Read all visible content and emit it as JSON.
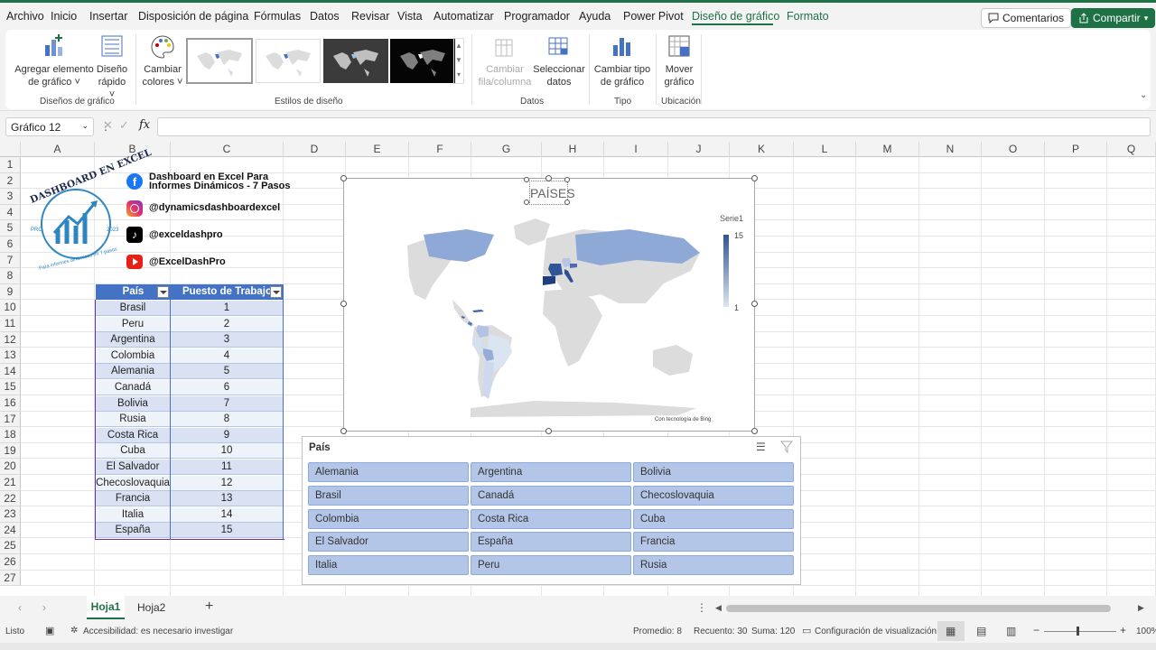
{
  "menu": {
    "items": [
      "Archivo",
      "Inicio",
      "Insertar",
      "Disposición de página",
      "Fórmulas",
      "Datos",
      "Revisar",
      "Vista",
      "Automatizar",
      "Programador",
      "Ayuda",
      "Power Pivot",
      "Diseño de gráfico",
      "Formato"
    ],
    "active": "Diseño de gráfico",
    "comments_label": "Comentarios",
    "share_label": "Compartir"
  },
  "ribbon": {
    "add_element": [
      "Agregar elemento",
      "de gráfico ˅"
    ],
    "quick_layout": [
      "Diseño",
      "rápido ˅"
    ],
    "change_colors": [
      "Cambiar",
      "colores ˅"
    ],
    "switch_row_col": [
      "Cambiar",
      "fila/columna"
    ],
    "select_data": [
      "Seleccionar",
      "datos"
    ],
    "change_type": [
      "Cambiar tipo",
      "de gráfico"
    ],
    "move_chart": [
      "Mover",
      "gráfico"
    ],
    "groups": {
      "layouts": "Diseños de gráfico",
      "styles": "Estilos de diseño",
      "data": "Datos",
      "type": "Tipo",
      "location": "Ubicación"
    }
  },
  "formula": {
    "namebox": "Gráfico 12",
    "fx": "fx"
  },
  "columns": [
    "A",
    "B",
    "C",
    "D",
    "E",
    "F",
    "G",
    "H",
    "I",
    "J",
    "K",
    "L",
    "M",
    "N",
    "O",
    "P",
    "Q"
  ],
  "rows": [
    "1",
    "2",
    "3",
    "4",
    "5",
    "6",
    "7",
    "8",
    "9",
    "10",
    "11",
    "12",
    "13",
    "14",
    "15",
    "16",
    "17",
    "18",
    "19",
    "20",
    "21",
    "22",
    "23",
    "24",
    "25",
    "26",
    "27"
  ],
  "brand": {
    "logo_top": "DASHBOARD EN EXCEL",
    "logo_left": "PRO",
    "logo_right": "2023",
    "logo_bottom": "Para informes dinámicos en 7 pasos",
    "facebook": [
      "Dashboard en Excel Para",
      "Informes Dinámicos -  7 Pasos"
    ],
    "instagram": "@dynamicsdashboardexcel",
    "tiktok": "@exceldashpro",
    "youtube": "@ExcelDashPro"
  },
  "table": {
    "headers": [
      "País",
      "Puesto de Trabajo"
    ],
    "rows": [
      [
        "Brasil",
        "1"
      ],
      [
        "Peru",
        "2"
      ],
      [
        "Argentina",
        "3"
      ],
      [
        "Colombia",
        "4"
      ],
      [
        "Alemania",
        "5"
      ],
      [
        "Canadá",
        "6"
      ],
      [
        "Bolivia",
        "7"
      ],
      [
        "Rusia",
        "8"
      ],
      [
        "Costa Rica",
        "9"
      ],
      [
        "Cuba",
        "10"
      ],
      [
        "El Salvador",
        "11"
      ],
      [
        "Checoslovaquia",
        "12"
      ],
      [
        "Francia",
        "13"
      ],
      [
        "Italia",
        "14"
      ],
      [
        "España",
        "15"
      ]
    ]
  },
  "chart": {
    "title": "PAÍSES",
    "legend_title": "Serie1",
    "legend_max": "15",
    "legend_min": "1",
    "credit": "Con tecnología de Bing",
    "color_low": "#dce6f2",
    "color_high": "#2f5597"
  },
  "chart_data": {
    "type": "map",
    "title": "PAÍSES",
    "series": [
      {
        "name": "Serie1",
        "values": [
          1,
          2,
          3,
          4,
          5,
          6,
          7,
          8,
          9,
          10,
          11,
          12,
          13,
          14,
          15
        ]
      }
    ],
    "categories": [
      "Brasil",
      "Peru",
      "Argentina",
      "Colombia",
      "Alemania",
      "Canadá",
      "Bolivia",
      "Rusia",
      "Costa Rica",
      "Cuba",
      "El Salvador",
      "Checoslovaquia",
      "Francia",
      "Italia",
      "España"
    ],
    "value_range": [
      1,
      15
    ]
  },
  "slicer": {
    "title": "País",
    "items": [
      "Alemania",
      "Argentina",
      "Bolivia",
      "Brasil",
      "Canadá",
      "Checoslovaquia",
      "Colombia",
      "Costa Rica",
      "Cuba",
      "El Salvador",
      "España",
      "Francia",
      "Italia",
      "Peru",
      "Rusia"
    ]
  },
  "sheets": {
    "tabs": [
      "Hoja1",
      "Hoja2"
    ],
    "active": "Hoja1"
  },
  "status": {
    "ready": "Listo",
    "accessibility": "Accesibilidad: es necesario investigar",
    "average": "Promedio: 8",
    "count": "Recuento: 30",
    "sum": "Suma: 120",
    "view_settings": "Configuración de visualización",
    "zoom": "100%"
  }
}
